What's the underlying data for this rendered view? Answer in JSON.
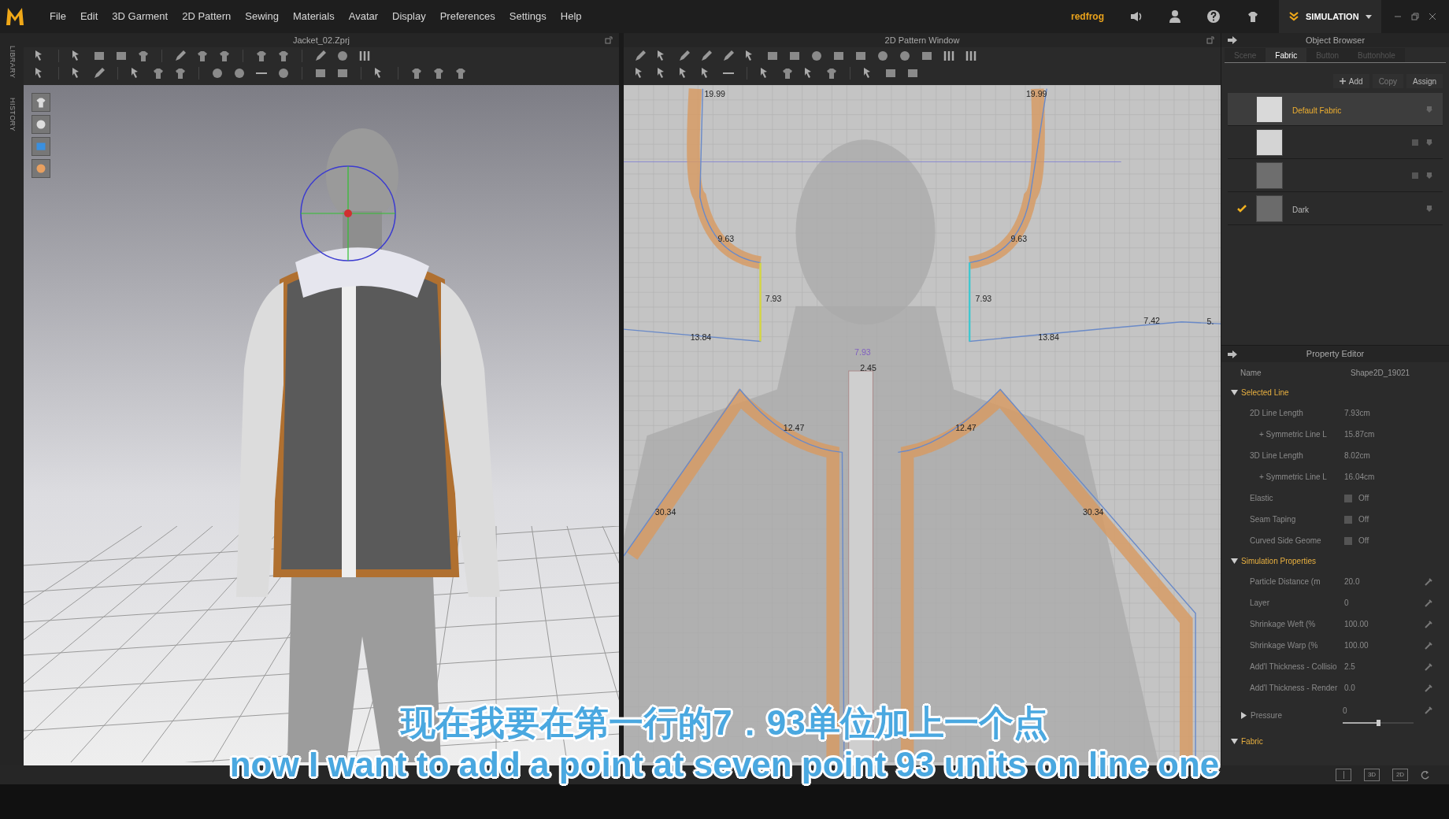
{
  "menu": [
    "File",
    "Edit",
    "3D Garment",
    "2D Pattern",
    "Sewing",
    "Materials",
    "Avatar",
    "Display",
    "Preferences",
    "Settings",
    "Help"
  ],
  "user": "redfrog",
  "mode": "SIMULATION",
  "side_tabs": [
    "LIBRARY",
    "HISTORY"
  ],
  "window_3d": {
    "title": "Jacket_02.Zprj"
  },
  "window_2d": {
    "title": "2D Pattern Window",
    "labels": [
      {
        "text": "19.99"
      },
      {
        "text": "19.99"
      },
      {
        "text": "9.63"
      },
      {
        "text": "9.63"
      },
      {
        "text": "7.93"
      },
      {
        "text": "7.93"
      },
      {
        "text": "13.84"
      },
      {
        "text": "13.84"
      },
      {
        "text": "7.42"
      },
      {
        "text": "5."
      },
      {
        "text": "7.93"
      },
      {
        "text": "2.45"
      },
      {
        "text": "12.47"
      },
      {
        "text": "12.47"
      },
      {
        "text": "30.34"
      },
      {
        "text": "30.34"
      }
    ]
  },
  "object_browser": {
    "title": "Object Browser",
    "tabs": [
      {
        "label": "Scene",
        "selected": false
      },
      {
        "label": "Fabric",
        "selected": true
      },
      {
        "label": "Button",
        "selected": false
      },
      {
        "label": "Buttonhole",
        "selected": false
      }
    ],
    "actions": [
      {
        "label": "Add",
        "disabled": false
      },
      {
        "label": "Copy",
        "disabled": true
      },
      {
        "label": "Assign",
        "disabled": false
      }
    ],
    "fabrics": [
      {
        "name": "Default Fabric",
        "selected": true,
        "checked": false,
        "color": "#d9d9d9",
        "deletable": false
      },
      {
        "selected": false,
        "checked": false,
        "color": "#d4d4d4",
        "deletable": true
      },
      {
        "selected": false,
        "checked": false,
        "color": "#6e6e6e",
        "deletable": true
      },
      {
        "name": "Dark",
        "selected": false,
        "checked": true,
        "color": "#6b6b6b",
        "deletable": false
      }
    ]
  },
  "property_editor": {
    "title": "Property Editor",
    "name_label": "Name",
    "name_value": "Shape2D_19021",
    "sections": [
      {
        "title": "Selected Line",
        "expanded": true,
        "rows": [
          {
            "kind": "text",
            "label": "2D Line Length",
            "value": "7.93cm",
            "indent": false
          },
          {
            "kind": "text",
            "label": "+ Symmetric Line L",
            "value": "15.87cm",
            "indent": true
          },
          {
            "kind": "text",
            "label": "3D Line Length",
            "value": "8.02cm",
            "indent": false
          },
          {
            "kind": "text",
            "label": "+ Symmetric Line L",
            "value": "16.04cm",
            "indent": true
          },
          {
            "kind": "toggle",
            "label": "Elastic",
            "value": "Off",
            "on": false
          },
          {
            "kind": "toggle",
            "label": "Seam Taping",
            "value": "Off",
            "on": false
          },
          {
            "kind": "toggle",
            "label": "Curved Side Geome",
            "value": "Off",
            "on": false
          }
        ]
      },
      {
        "title": "Simulation Properties",
        "expanded": true,
        "rows": [
          {
            "kind": "number",
            "label": "Particle Distance (m",
            "value": "20.0"
          },
          {
            "kind": "number",
            "label": "Layer",
            "value": "0"
          },
          {
            "kind": "number",
            "label": "Shrinkage Weft (%",
            "value": "100.00"
          },
          {
            "kind": "number",
            "label": "Shrinkage Warp (%",
            "value": "100.00"
          },
          {
            "kind": "number",
            "label": "Add'l Thickness - Collisio",
            "value": "2.5"
          },
          {
            "kind": "number",
            "label": "Add'l Thickness - Render",
            "value": "0.0"
          }
        ]
      },
      {
        "title": "Pressure",
        "expanded": false,
        "rows": [
          {
            "kind": "slider",
            "value": "0",
            "level": 0.5
          }
        ]
      },
      {
        "title": "Fabric",
        "expanded": true
      }
    ]
  },
  "view_buttons": [
    {
      "kind": "split"
    },
    {
      "kind": "label",
      "label": "3D"
    },
    {
      "kind": "label",
      "label": "2D"
    }
  ],
  "subtitles": {
    "zh": "现在我要在第一行的7．93单位加上一个点",
    "en": "now I want to add a point at seven point 93 units on line one"
  }
}
